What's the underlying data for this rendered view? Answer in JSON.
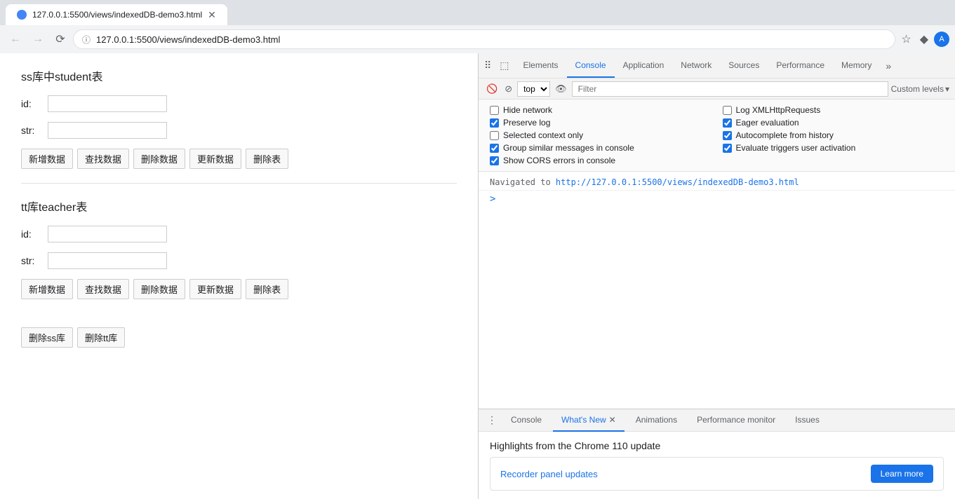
{
  "browser": {
    "tab_title": "127.0.0.1:5500/views/indexedDB-demo3.html",
    "url": "127.0.0.1:5500/views/indexedDB-demo3.html",
    "full_url": "http://127.0.0.1:5500/views/indexedDB-demo3.html"
  },
  "page": {
    "section1": {
      "title": "ss库中student表",
      "id_label": "id:",
      "str_label": "str:",
      "btn_add": "新增数据",
      "btn_find": "查找数据",
      "btn_delete": "删除数据",
      "btn_update": "更新数据",
      "btn_drop": "删除表"
    },
    "section2": {
      "title": "tt库teacher表",
      "id_label": "id:",
      "str_label": "str:",
      "btn_add": "新增数据",
      "btn_find": "查找数据",
      "btn_delete": "删除数据",
      "btn_update": "更新数据",
      "btn_drop": "删除表"
    },
    "btn_delete_ss": "删除ss库",
    "btn_delete_tt": "删除tt库"
  },
  "devtools": {
    "tabs": [
      {
        "label": "Elements",
        "active": false
      },
      {
        "label": "Console",
        "active": true
      },
      {
        "label": "Application",
        "active": false
      },
      {
        "label": "Network",
        "active": false
      },
      {
        "label": "Sources",
        "active": false
      },
      {
        "label": "Performance",
        "active": false
      },
      {
        "label": "Memory",
        "active": false
      }
    ],
    "more_label": "»",
    "console_toolbar": {
      "top_label": "top",
      "filter_placeholder": "Filter",
      "custom_levels": "Custom levels",
      "dropdown_arrow": "▾"
    },
    "options": [
      {
        "id": "hide-network",
        "label": "Hide network",
        "checked": false
      },
      {
        "id": "log-xml",
        "label": "Log XMLHttpRequests",
        "checked": false
      },
      {
        "id": "preserve-log",
        "label": "Preserve log",
        "checked": true
      },
      {
        "id": "eager-eval",
        "label": "Eager evaluation",
        "checked": true
      },
      {
        "id": "selected-context",
        "label": "Selected context only",
        "checked": false
      },
      {
        "id": "autocomplete",
        "label": "Autocomplete from history",
        "checked": true
      },
      {
        "id": "group-similar",
        "label": "Group similar messages in console",
        "checked": true
      },
      {
        "id": "eval-triggers",
        "label": "Evaluate triggers user activation",
        "checked": true
      },
      {
        "id": "show-cors",
        "label": "Show CORS errors in console",
        "checked": true
      }
    ],
    "console_output": {
      "nav_text": "Navigated to ",
      "nav_link": "http://127.0.0.1:5500/views/indexedDB-demo3.html"
    },
    "drawer": {
      "tabs": [
        {
          "label": "Console",
          "active": false,
          "closable": false
        },
        {
          "label": "What's New",
          "active": true,
          "closable": true
        },
        {
          "label": "Animations",
          "active": false,
          "closable": false
        },
        {
          "label": "Performance monitor",
          "active": false,
          "closable": false
        },
        {
          "label": "Issues",
          "active": false,
          "closable": false
        }
      ],
      "title": "Highlights from the Chrome 110 update",
      "card_text": "Recorder panel updates",
      "card_btn": "Learn more"
    }
  }
}
